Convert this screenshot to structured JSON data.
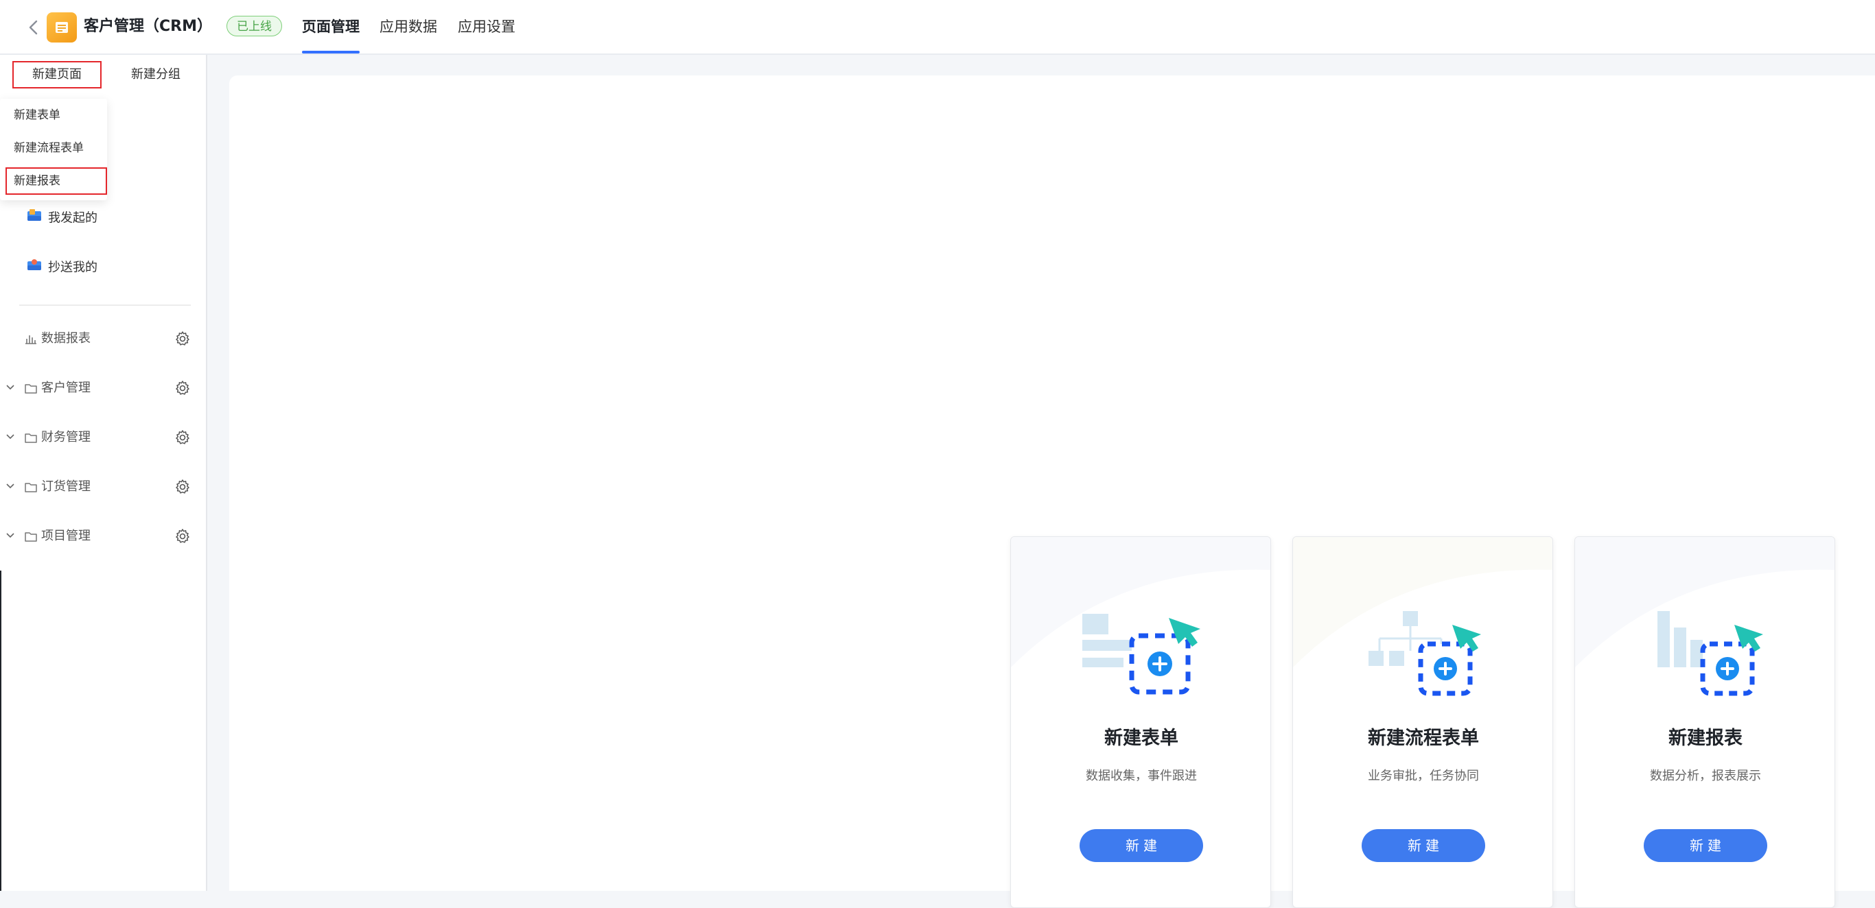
{
  "header": {
    "app_title": "客户管理（CRM）",
    "status": "已上线",
    "tabs": [
      {
        "label": "页面管理",
        "active": true
      },
      {
        "label": "应用数据",
        "active": false
      },
      {
        "label": "应用设置",
        "active": false
      }
    ],
    "accent_color": "#3370ff"
  },
  "sidebar": {
    "top_tabs": {
      "new_page": "新建页面",
      "new_group": "新建分组"
    },
    "dropdown": {
      "items": [
        "新建表单",
        "新建流程表单",
        "新建报表"
      ],
      "highlighted": "新建报表"
    },
    "items": [
      {
        "label": "我发起的",
        "icon": "sent-tray-icon"
      },
      {
        "label": "抄送我的",
        "icon": "cc-tray-icon"
      }
    ],
    "groups": [
      {
        "label": "数据报表",
        "icon": "bar-chart-icon",
        "expandable": false
      },
      {
        "label": "客户管理",
        "icon": "folder-icon",
        "expandable": true
      },
      {
        "label": "财务管理",
        "icon": "folder-icon",
        "expandable": true
      },
      {
        "label": "订货管理",
        "icon": "folder-icon",
        "expandable": true
      },
      {
        "label": "项目管理",
        "icon": "folder-icon",
        "expandable": true
      }
    ]
  },
  "main": {
    "cards": [
      {
        "title": "新建表单",
        "desc": "数据收集，事件跟进",
        "button": "新建",
        "icon": "form-illustration"
      },
      {
        "title": "新建流程表单",
        "desc": "业务审批，任务协同",
        "button": "新建",
        "icon": "flow-illustration"
      },
      {
        "title": "新建报表",
        "desc": "数据分析，报表展示",
        "button": "新建",
        "icon": "report-illustration"
      }
    ],
    "button_color": "#3e7bef"
  }
}
